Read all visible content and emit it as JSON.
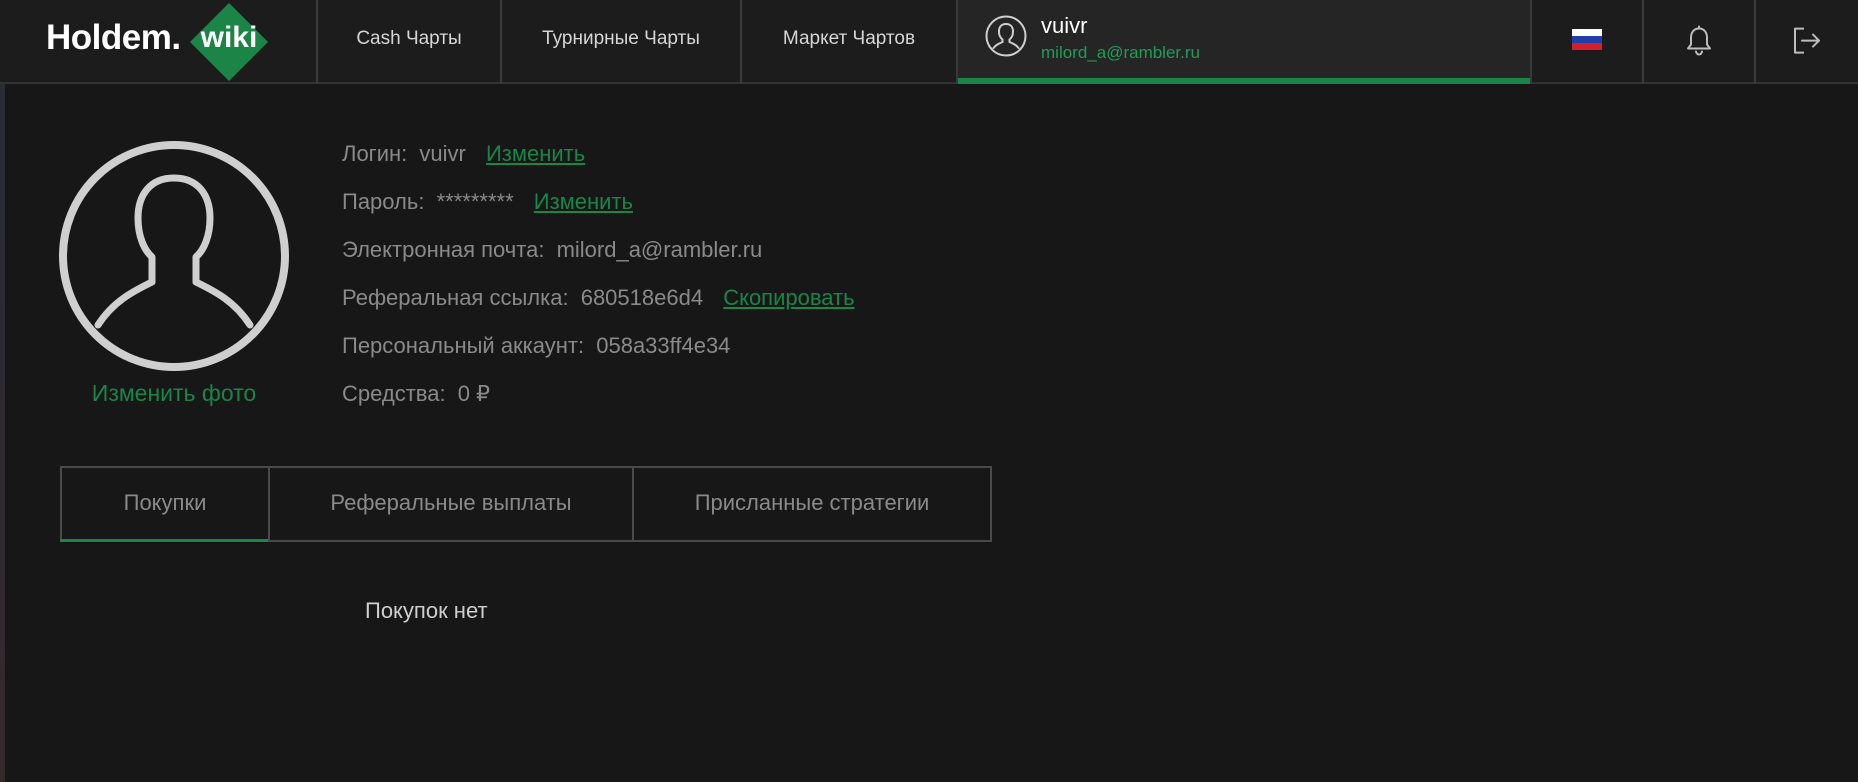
{
  "header": {
    "logo_text": "Holdem.",
    "logo_badge": "wiki",
    "nav": {
      "cash": "Cash Чарты",
      "tournament": "Турнирные Чарты",
      "market": "Маркет Чартов"
    },
    "user": {
      "name": "vuivr",
      "email": "milord_a@rambler.ru"
    },
    "icons": [
      "russia-flag-icon",
      "bell-icon",
      "logout-icon"
    ]
  },
  "profile": {
    "change_photo": "Изменить фото",
    "login": {
      "label": "Логин:",
      "value": "vuivr",
      "action": "Изменить"
    },
    "password": {
      "label": "Пароль:",
      "value": "*********",
      "action": "Изменить"
    },
    "email": {
      "label": "Электронная почта:",
      "value": "milord_a@rambler.ru"
    },
    "referral": {
      "label": "Реферальная ссылка:",
      "value": "680518e6d4",
      "action": "Скопировать"
    },
    "account": {
      "label": "Персональный аккаунт:",
      "value": "058a33ff4e34"
    },
    "funds": {
      "label": "Средства:",
      "value": "0 ₽"
    }
  },
  "tabs": {
    "purchases": "Покупки",
    "referral_payouts": "Реферальные выплаты",
    "sent_strategies": "Присланные стратегии",
    "active": "purchases"
  },
  "content": {
    "empty_message": "Покупок нет"
  },
  "colors": {
    "background": "#171717",
    "header": "#1c1c1c",
    "accent_green": "#1b8548",
    "text_muted": "#8a8a8a"
  }
}
